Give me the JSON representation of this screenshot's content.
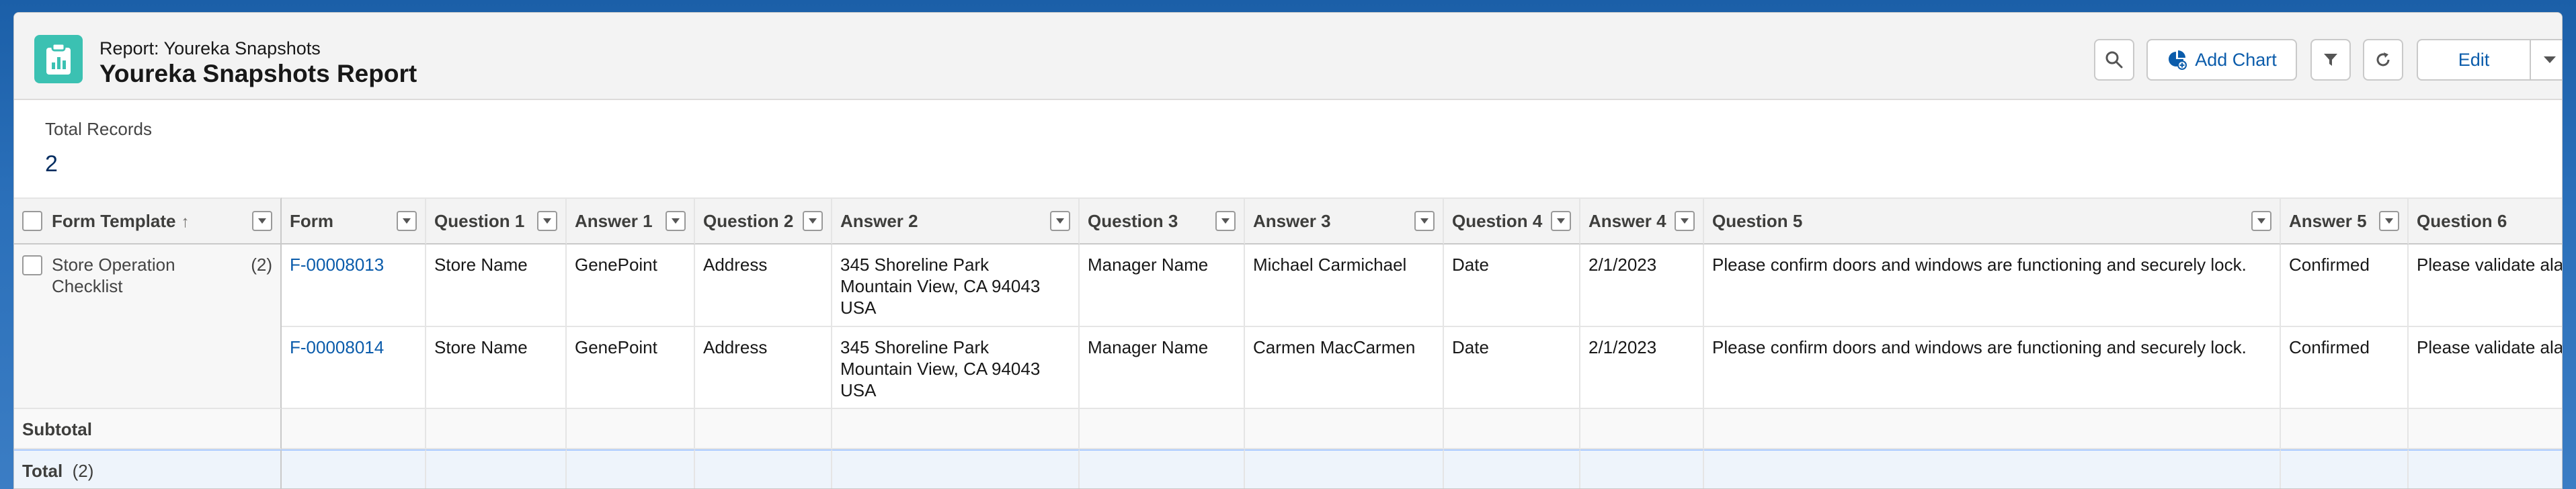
{
  "header": {
    "subtitle": "Report: Youreka Snapshots",
    "title": "Youreka Snapshots Report",
    "add_chart_label": "Add Chart",
    "edit_label": "Edit"
  },
  "summary": {
    "label": "Total Records",
    "value": "2"
  },
  "table": {
    "group_column": "Form Template",
    "group_sort": "↑",
    "columns": [
      "Form",
      "Question 1",
      "Answer 1",
      "Question 2",
      "Answer 2",
      "Question 3",
      "Answer 3",
      "Question 4",
      "Answer 4",
      "Question 5",
      "Answer 5",
      "Question 6"
    ],
    "group": {
      "label": "Store Operation Checklist",
      "count": "(2)"
    },
    "rows": [
      [
        "F-00008013",
        "Store Name",
        "GenePoint",
        "Address",
        "345 Shoreline Park\nMountain View, CA 94043\nUSA",
        "Manager Name",
        "Michael Carmichael",
        "Date",
        "2/1/2023",
        "Please confirm doors and windows are functioning and securely lock.",
        "Confirmed",
        "Please validate alar"
      ],
      [
        "F-00008014",
        "Store Name",
        "GenePoint",
        "Address",
        "345 Shoreline Park\nMountain View, CA 94043\nUSA",
        "Manager Name",
        "Carmen MacCarmen",
        "Date",
        "2/1/2023",
        "Please confirm doors and windows are functioning and securely lock.",
        "Confirmed",
        "Please validate alar"
      ]
    ],
    "subtotal_label": "Subtotal",
    "total_label": "Total",
    "total_count": "(2)"
  },
  "colors": {
    "app_icon": "#3bc1b2",
    "link": "#0b5cab",
    "header_bg": "#f3f3f3"
  },
  "icons": [
    "report-icon",
    "search-icon",
    "add-chart-icon",
    "filter-icon",
    "refresh-icon",
    "chevron-down-icon"
  ]
}
